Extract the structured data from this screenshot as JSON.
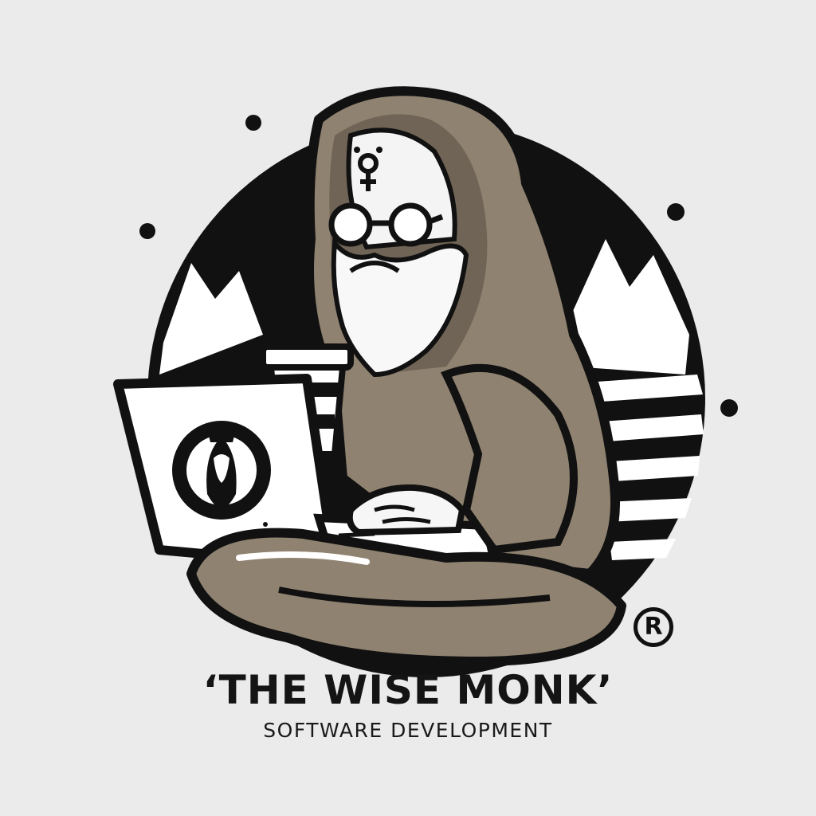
{
  "brand": {
    "title": "‘THE WISE MONK’",
    "tagline": "SOFTWARE DEVELOPMENT",
    "registered_mark": "®"
  },
  "colors": {
    "background": "#ebebeb",
    "ink": "#111111",
    "robe": "#8f8270",
    "robe_shadow": "#6f6455",
    "paper": "#ffffff"
  },
  "icons": {
    "forehead_symbol": "alchemy-symbol-icon",
    "laptop_logo": "coffee-brand-emblem-icon",
    "cup": "steaming-coffee-cup-icon"
  }
}
